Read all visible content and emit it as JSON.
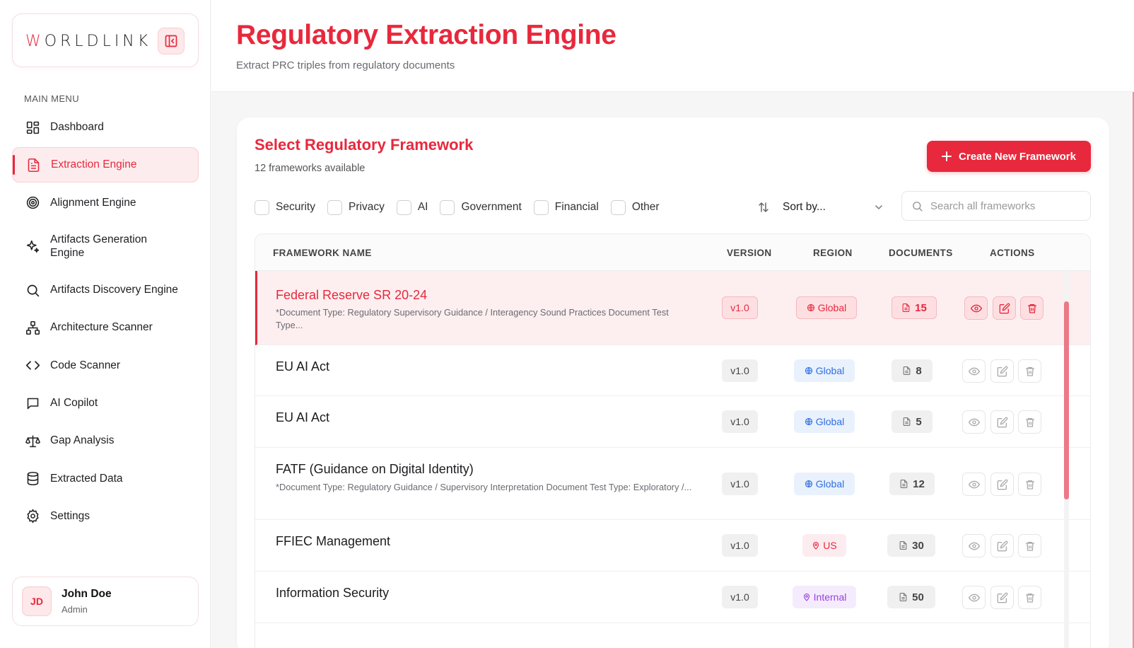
{
  "brand": {
    "logo_mark": "W",
    "logo_text": "ORLDLINK"
  },
  "sidebar": {
    "section_label": "MAIN MENU",
    "items": [
      {
        "label": "Dashboard",
        "icon": "grid-icon",
        "active": false
      },
      {
        "label": "Extraction Engine",
        "icon": "file-text-icon",
        "active": true
      },
      {
        "label": "Alignment Engine",
        "icon": "target-icon",
        "active": false
      },
      {
        "label": "Artifacts Generation Engine",
        "icon": "sparkles-icon",
        "active": false
      },
      {
        "label": "Artifacts Discovery Engine",
        "icon": "search-icon",
        "active": false
      },
      {
        "label": "Architecture Scanner",
        "icon": "network-icon",
        "active": false
      },
      {
        "label": "Code Scanner",
        "icon": "code-icon",
        "active": false
      },
      {
        "label": "AI Copilot",
        "icon": "chat-icon",
        "active": false
      },
      {
        "label": "Gap Analysis",
        "icon": "scale-icon",
        "active": false
      },
      {
        "label": "Extracted Data",
        "icon": "database-icon",
        "active": false
      },
      {
        "label": "Settings",
        "icon": "gear-icon",
        "active": false
      }
    ],
    "user": {
      "initials": "JD",
      "name": "John Doe",
      "role": "Admin"
    }
  },
  "header": {
    "title": "Regulatory Extraction Engine",
    "subtitle": "Extract PRC triples from regulatory documents"
  },
  "panel": {
    "title": "Select Regulatory Framework",
    "count_text": "12 frameworks available",
    "create_button": "Create New Framework",
    "filters": [
      "Security",
      "Privacy",
      "AI",
      "Government",
      "Financial",
      "Other"
    ],
    "sort_placeholder": "Sort by...",
    "search_placeholder": "Search all frameworks"
  },
  "table": {
    "columns": [
      "FRAMEWORK NAME",
      "VERSION",
      "REGION",
      "DOCUMENTS",
      "ACTIONS"
    ],
    "rows": [
      {
        "name": "Federal Reserve SR 20-24",
        "desc": "*Document Type: Regulatory Supervisory Guidance / Interagency Sound Practices Document Test Type...",
        "version": "v1.0",
        "region": "Global",
        "region_type": "global",
        "documents": "15",
        "active": true
      },
      {
        "name": "EU AI Act",
        "desc": "",
        "version": "v1.0",
        "region": "Global",
        "region_type": "global",
        "documents": "8",
        "active": false
      },
      {
        "name": "EU AI Act",
        "desc": "",
        "version": "v1.0",
        "region": "Global",
        "region_type": "global",
        "documents": "5",
        "active": false
      },
      {
        "name": "FATF (Guidance on Digital Identity)",
        "desc": "*Document Type: Regulatory Guidance / Supervisory Interpretation Document Test Type: Exploratory /...",
        "version": "v1.0",
        "region": "Global",
        "region_type": "global",
        "documents": "12",
        "active": false
      },
      {
        "name": "FFIEC Management",
        "desc": "",
        "version": "v1.0",
        "region": "US",
        "region_type": "us",
        "documents": "30",
        "active": false
      },
      {
        "name": "Information Security",
        "desc": "",
        "version": "v1.0",
        "region": "Internal",
        "region_type": "internal",
        "documents": "50",
        "active": false
      }
    ]
  },
  "colors": {
    "accent": "#e8283c",
    "global": "#2f6fe0",
    "internal": "#9a3ee0"
  }
}
